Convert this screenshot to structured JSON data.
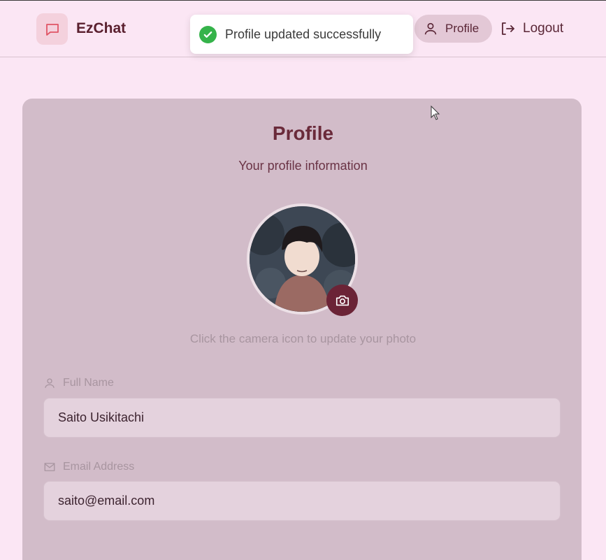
{
  "header": {
    "brand": "EzChat",
    "profile_label": "Profile",
    "logout_label": "Logout"
  },
  "toast": {
    "message": "Profile updated successfully"
  },
  "card": {
    "title": "Profile",
    "subtitle": "Your profile information",
    "photo_hint": "Click the camera icon to update your photo",
    "fields": [
      {
        "label": "Full Name",
        "value": "Saito Usikitachi",
        "icon": "user-icon"
      },
      {
        "label": "Email Address",
        "value": "saito@email.com",
        "icon": "mail-icon"
      }
    ]
  },
  "colors": {
    "background": "#fbe6f4",
    "card": "#d2bcc9",
    "accent": "#6b2336",
    "success": "#35b34a"
  }
}
